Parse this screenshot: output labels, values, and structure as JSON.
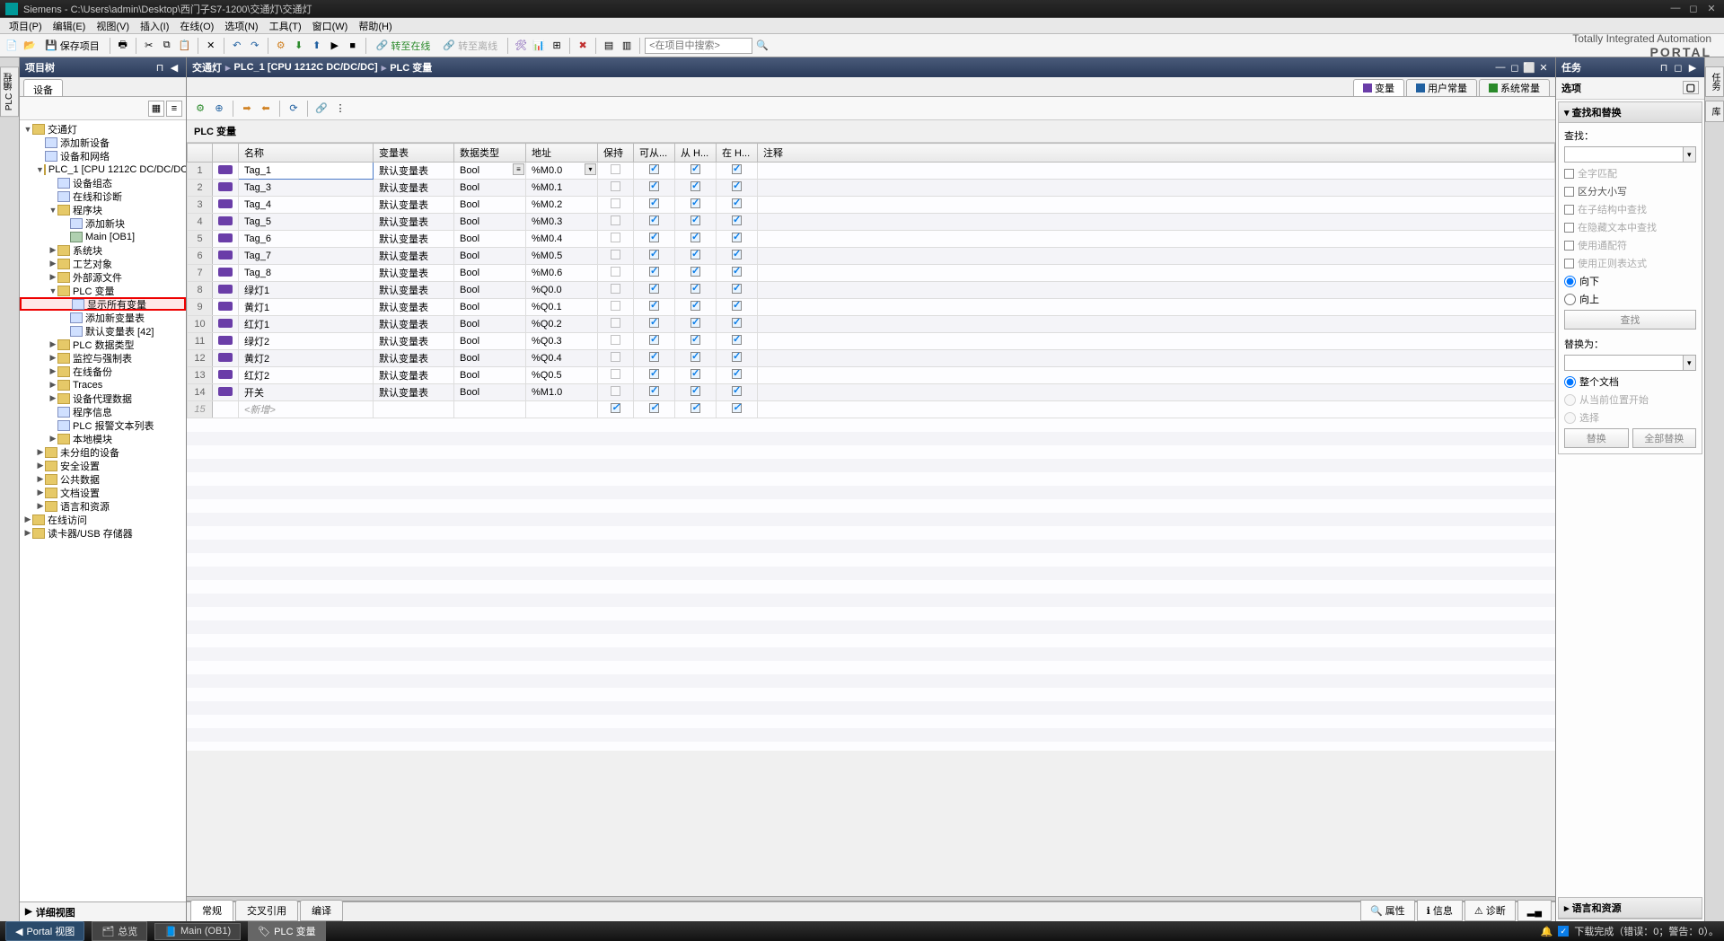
{
  "titlebar": {
    "app": "Siemens",
    "sep": " - ",
    "path": "C:\\Users\\admin\\Desktop\\西门子S7-1200\\交通灯\\交通灯"
  },
  "menu": [
    "项目(P)",
    "编辑(E)",
    "视图(V)",
    "插入(I)",
    "在线(O)",
    "选项(N)",
    "工具(T)",
    "窗口(W)",
    "帮助(H)"
  ],
  "toolbar": {
    "save": "保存项目",
    "goOnline": "转至在线",
    "goOffline": "转至离线",
    "searchPlaceholder": "<在项目中搜索>"
  },
  "brand": {
    "line1": "Totally Integrated Automation",
    "line2": "PORTAL"
  },
  "leftStripTab": "PLC 编程",
  "projectTree": {
    "header": "项目树",
    "tab": "设备",
    "detailHeader": "详细视图",
    "nodes": [
      {
        "indent": 0,
        "arrow": "▼",
        "icon": "folder",
        "label": "交通灯"
      },
      {
        "indent": 1,
        "arrow": "",
        "icon": "file",
        "label": "添加新设备"
      },
      {
        "indent": 1,
        "arrow": "",
        "icon": "file",
        "label": "设备和网络"
      },
      {
        "indent": 1,
        "arrow": "▼",
        "icon": "folder",
        "label": "PLC_1 [CPU 1212C DC/DC/DC]"
      },
      {
        "indent": 2,
        "arrow": "",
        "icon": "file",
        "label": "设备组态"
      },
      {
        "indent": 2,
        "arrow": "",
        "icon": "file",
        "label": "在线和诊断"
      },
      {
        "indent": 2,
        "arrow": "▼",
        "icon": "folder",
        "label": "程序块"
      },
      {
        "indent": 3,
        "arrow": "",
        "icon": "file",
        "label": "添加新块"
      },
      {
        "indent": 3,
        "arrow": "",
        "icon": "db",
        "label": "Main [OB1]"
      },
      {
        "indent": 2,
        "arrow": "▶",
        "icon": "folder",
        "label": "系统块"
      },
      {
        "indent": 2,
        "arrow": "▶",
        "icon": "folder",
        "label": "工艺对象"
      },
      {
        "indent": 2,
        "arrow": "▶",
        "icon": "folder",
        "label": "外部源文件"
      },
      {
        "indent": 2,
        "arrow": "▼",
        "icon": "folder",
        "label": "PLC 变量"
      },
      {
        "indent": 3,
        "arrow": "",
        "icon": "file",
        "label": "显示所有变量",
        "highlight": true
      },
      {
        "indent": 3,
        "arrow": "",
        "icon": "file",
        "label": "添加新变量表"
      },
      {
        "indent": 3,
        "arrow": "",
        "icon": "file",
        "label": "默认变量表 [42]"
      },
      {
        "indent": 2,
        "arrow": "▶",
        "icon": "folder",
        "label": "PLC 数据类型"
      },
      {
        "indent": 2,
        "arrow": "▶",
        "icon": "folder",
        "label": "监控与强制表"
      },
      {
        "indent": 2,
        "arrow": "▶",
        "icon": "folder",
        "label": "在线备份"
      },
      {
        "indent": 2,
        "arrow": "▶",
        "icon": "folder",
        "label": "Traces"
      },
      {
        "indent": 2,
        "arrow": "▶",
        "icon": "folder",
        "label": "设备代理数据"
      },
      {
        "indent": 2,
        "arrow": "",
        "icon": "file",
        "label": "程序信息"
      },
      {
        "indent": 2,
        "arrow": "",
        "icon": "file",
        "label": "PLC 报警文本列表"
      },
      {
        "indent": 2,
        "arrow": "▶",
        "icon": "folder",
        "label": "本地模块"
      },
      {
        "indent": 1,
        "arrow": "▶",
        "icon": "folder",
        "label": "未分组的设备"
      },
      {
        "indent": 1,
        "arrow": "▶",
        "icon": "folder",
        "label": "安全设置"
      },
      {
        "indent": 1,
        "arrow": "▶",
        "icon": "folder",
        "label": "公共数据"
      },
      {
        "indent": 1,
        "arrow": "▶",
        "icon": "folder",
        "label": "文档设置"
      },
      {
        "indent": 1,
        "arrow": "▶",
        "icon": "folder",
        "label": "语言和资源"
      },
      {
        "indent": 0,
        "arrow": "▶",
        "icon": "folder",
        "label": "在线访问"
      },
      {
        "indent": 0,
        "arrow": "▶",
        "icon": "folder",
        "label": "读卡器/USB 存储器"
      }
    ]
  },
  "breadcrumb": [
    "交通灯",
    "PLC_1 [CPU 1212C DC/DC/DC]",
    "PLC 变量"
  ],
  "centerTabs": [
    {
      "label": "变量",
      "active": true,
      "iconColor": "#6a3da8"
    },
    {
      "label": "用户常量",
      "active": false,
      "iconColor": "#2060a0"
    },
    {
      "label": "系统常量",
      "active": false,
      "iconColor": "#2a8a2a"
    }
  ],
  "tableTitle": "PLC 变量",
  "columns": [
    "",
    "",
    "名称",
    "变量表",
    "数据类型",
    "地址",
    "保持",
    "可从...",
    "从 H...",
    "在 H...",
    "注释"
  ],
  "rows": [
    {
      "n": 1,
      "name": "Tag_1",
      "table": "默认变量表",
      "type": "Bool",
      "addr": "%M0.0",
      "retain": false,
      "a": true,
      "b": true,
      "c": true,
      "selected": true
    },
    {
      "n": 2,
      "name": "Tag_3",
      "table": "默认变量表",
      "type": "Bool",
      "addr": "%M0.1",
      "retain": false,
      "a": true,
      "b": true,
      "c": true
    },
    {
      "n": 3,
      "name": "Tag_4",
      "table": "默认变量表",
      "type": "Bool",
      "addr": "%M0.2",
      "retain": false,
      "a": true,
      "b": true,
      "c": true
    },
    {
      "n": 4,
      "name": "Tag_5",
      "table": "默认变量表",
      "type": "Bool",
      "addr": "%M0.3",
      "retain": false,
      "a": true,
      "b": true,
      "c": true
    },
    {
      "n": 5,
      "name": "Tag_6",
      "table": "默认变量表",
      "type": "Bool",
      "addr": "%M0.4",
      "retain": false,
      "a": true,
      "b": true,
      "c": true
    },
    {
      "n": 6,
      "name": "Tag_7",
      "table": "默认变量表",
      "type": "Bool",
      "addr": "%M0.5",
      "retain": false,
      "a": true,
      "b": true,
      "c": true
    },
    {
      "n": 7,
      "name": "Tag_8",
      "table": "默认变量表",
      "type": "Bool",
      "addr": "%M0.6",
      "retain": false,
      "a": true,
      "b": true,
      "c": true
    },
    {
      "n": 8,
      "name": "绿灯1",
      "table": "默认变量表",
      "type": "Bool",
      "addr": "%Q0.0",
      "retain": false,
      "a": true,
      "b": true,
      "c": true
    },
    {
      "n": 9,
      "name": "黄灯1",
      "table": "默认变量表",
      "type": "Bool",
      "addr": "%Q0.1",
      "retain": false,
      "a": true,
      "b": true,
      "c": true
    },
    {
      "n": 10,
      "name": "红灯1",
      "table": "默认变量表",
      "type": "Bool",
      "addr": "%Q0.2",
      "retain": false,
      "a": true,
      "b": true,
      "c": true
    },
    {
      "n": 11,
      "name": "绿灯2",
      "table": "默认变量表",
      "type": "Bool",
      "addr": "%Q0.3",
      "retain": false,
      "a": true,
      "b": true,
      "c": true
    },
    {
      "n": 12,
      "name": "黄灯2",
      "table": "默认变量表",
      "type": "Bool",
      "addr": "%Q0.4",
      "retain": false,
      "a": true,
      "b": true,
      "c": true
    },
    {
      "n": 13,
      "name": "红灯2",
      "table": "默认变量表",
      "type": "Bool",
      "addr": "%Q0.5",
      "retain": false,
      "a": true,
      "b": true,
      "c": true
    },
    {
      "n": 14,
      "name": "开关",
      "table": "默认变量表",
      "type": "Bool",
      "addr": "%M1.0",
      "retain": false,
      "a": true,
      "b": true,
      "c": true
    }
  ],
  "newRow": {
    "n": 15,
    "name": "<新增>"
  },
  "bottomTabs": [
    "常规",
    "交叉引用",
    "编译"
  ],
  "rightBottomTabs": [
    "属性",
    "信息",
    "诊断"
  ],
  "tasks": {
    "header": "任务",
    "options": "选项",
    "findReplace": "查找和替换",
    "findLabel": "查找：",
    "wholeWord": "全字匹配",
    "caseSensitive": "区分大小写",
    "inSubstructure": "在子结构中查找",
    "inHidden": "在隐藏文本中查找",
    "useWildcard": "使用通配符",
    "useRegex": "使用正则表达式",
    "down": "向下",
    "up": "向上",
    "findBtn": "查找",
    "replaceLabel": "替换为：",
    "wholeDoc": "整个文档",
    "fromCursor": "从当前位置开始",
    "selection": "选择",
    "replaceBtn": "替换",
    "replaceAllBtn": "全部替换",
    "langRes": "语言和资源"
  },
  "rightStripTabs": [
    "任务",
    "库"
  ],
  "appbar": {
    "portalView": "Portal 视图",
    "overview": "总览",
    "mainOB": "Main (OB1)",
    "plcVar": "PLC 变量",
    "status": "下载完成（错误：0；警告：0）。"
  }
}
